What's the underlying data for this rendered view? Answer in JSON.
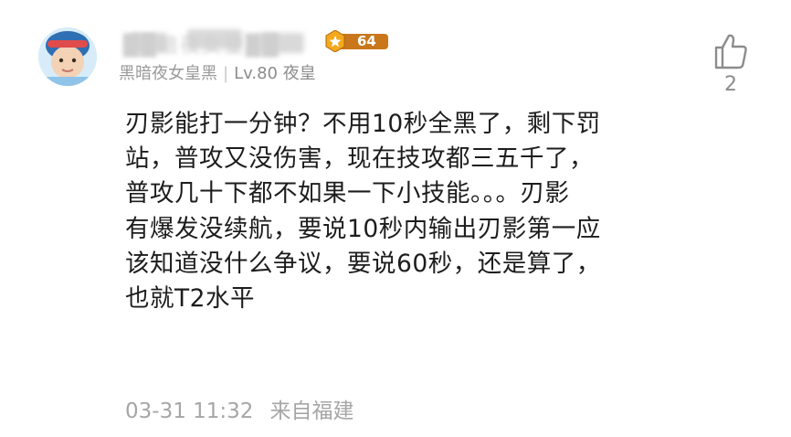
{
  "user": {
    "name": "██暗夜女皇██",
    "level_badge": "64",
    "sub_nick": "黑暗夜女皇黑",
    "level_label": "Lv.80 夜皇"
  },
  "like": {
    "count": "2",
    "icon": "thumbs-up-icon"
  },
  "comment": {
    "lines": [
      "刃影能打一分钟？不用10秒全黑了，剩下罚",
      "站，普攻又没伤害，现在技攻都三五千了，",
      "普攻几十下都不如果一下小技能。。。刃影",
      "有爆发没续航，要说10秒内输出刃影第一应",
      "该知道没什么争议，要说60秒，还是算了，",
      "也就T2水平"
    ]
  },
  "meta": {
    "time": "03-31 11:32",
    "location": "来自福建"
  },
  "colors": {
    "badge_gold": "#f2a91c",
    "badge_bg": "#c9771a",
    "muted": "#a6a6a6"
  }
}
